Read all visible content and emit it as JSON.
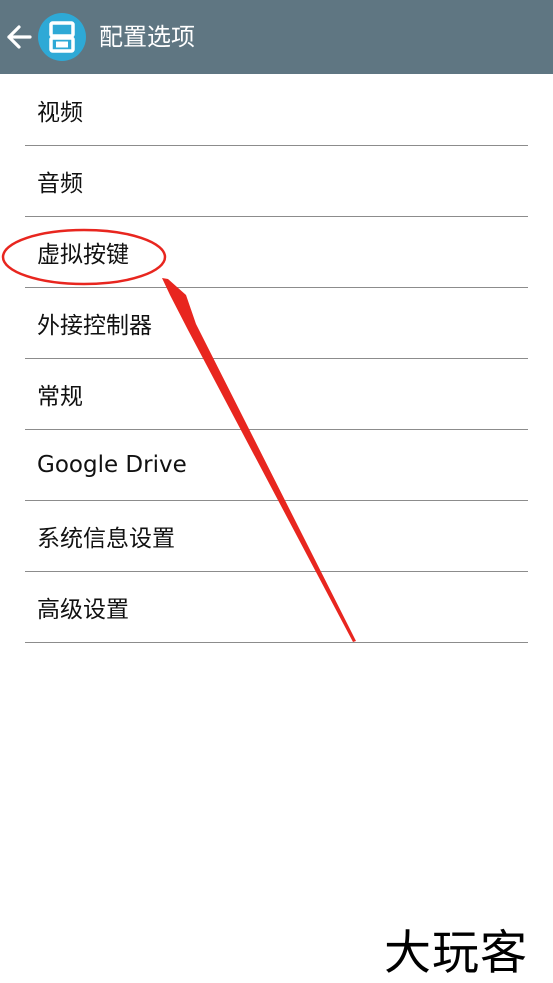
{
  "header": {
    "title": "配置选项",
    "back_icon": "arrow-left-icon",
    "app_icon": "dual-screen-icon",
    "bar_color": "#5f7682",
    "logo_color": "#2ea9d6"
  },
  "settings": {
    "items": [
      {
        "label": "视频"
      },
      {
        "label": "音频"
      },
      {
        "label": "虚拟按键"
      },
      {
        "label": "外接控制器"
      },
      {
        "label": "常规"
      },
      {
        "label": "Google Drive"
      },
      {
        "label": "系统信息设置"
      },
      {
        "label": "高级设置"
      }
    ]
  },
  "annotation": {
    "color": "#e8261f",
    "shapes": [
      "circle-highlight",
      "arrow"
    ]
  },
  "watermark": {
    "text": "大玩客"
  }
}
